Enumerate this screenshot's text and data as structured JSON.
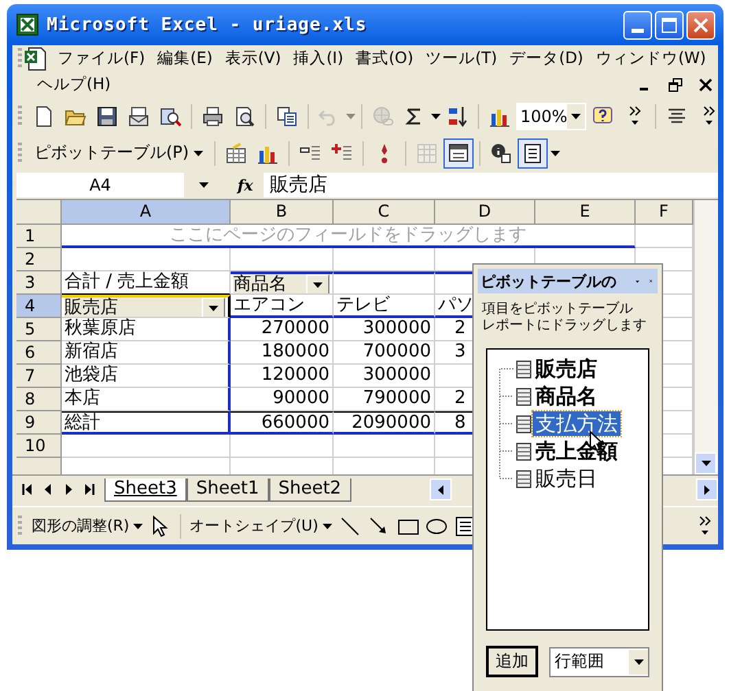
{
  "window": {
    "title": "Microsoft Excel - uriage.xls"
  },
  "menu_bar": {
    "items": [
      "ファイル(F)",
      "編集(E)",
      "表示(V)",
      "挿入(I)",
      "書式(O)",
      "ツール(T)",
      "データ(D)",
      "ウィンドウ(W)",
      "ヘルプ(H)"
    ]
  },
  "standard_toolbar": {
    "buttons": [
      {
        "kind": "new",
        "disabled": false
      },
      {
        "kind": "open",
        "disabled": false
      },
      {
        "kind": "save",
        "disabled": false
      },
      {
        "kind": "mail",
        "disabled": false
      },
      {
        "kind": "research",
        "disabled": false
      },
      {
        "kind": "separator"
      },
      {
        "kind": "print",
        "disabled": false
      },
      {
        "kind": "preview",
        "disabled": false
      },
      {
        "kind": "separator"
      },
      {
        "kind": "copy",
        "disabled": false
      },
      {
        "kind": "separator"
      },
      {
        "kind": "undo",
        "disabled": true
      },
      {
        "kind": "separator"
      },
      {
        "kind": "hyperlink",
        "disabled": true
      },
      {
        "kind": "autosum",
        "disabled": false
      },
      {
        "kind": "sort",
        "disabled": false
      },
      {
        "kind": "separator"
      },
      {
        "kind": "chart",
        "disabled": false
      },
      {
        "kind": "zoom",
        "value": "100%"
      },
      {
        "kind": "help",
        "disabled": false
      },
      {
        "kind": "more"
      },
      {
        "kind": "separator"
      },
      {
        "kind": "align",
        "disabled": false
      },
      {
        "kind": "more"
      }
    ]
  },
  "pivot_toolbar": {
    "menu": "ピボットテーブル(P)",
    "buttons": [
      {
        "kind": "separator"
      },
      {
        "kind": "format",
        "disabled": false,
        "pressed": false
      },
      {
        "kind": "chart",
        "disabled": false,
        "pressed": false
      },
      {
        "kind": "separator"
      },
      {
        "kind": "hide",
        "disabled": false,
        "pressed": false
      },
      {
        "kind": "show",
        "disabled": false,
        "pressed": false
      },
      {
        "kind": "separator"
      },
      {
        "kind": "refresh",
        "disabled": false,
        "pressed": false
      },
      {
        "kind": "separator"
      },
      {
        "kind": "hidden_items",
        "disabled": true,
        "pressed": false
      },
      {
        "kind": "always_show",
        "disabled": false,
        "pressed": true
      },
      {
        "kind": "separator"
      },
      {
        "kind": "settings",
        "disabled": false,
        "pressed": false
      },
      {
        "kind": "field_list",
        "disabled": false,
        "pressed": true
      }
    ]
  },
  "formula_bar": {
    "name_box": "A4",
    "function_label": "fx",
    "formula": "販売店"
  },
  "sheet": {
    "columns": [
      {
        "label": "A",
        "selected": true
      },
      {
        "label": "B",
        "selected": false
      },
      {
        "label": "C",
        "selected": false
      },
      {
        "label": "D",
        "selected": false
      },
      {
        "label": "E",
        "selected": false
      },
      {
        "label": "F",
        "selected": false
      }
    ],
    "rows": [
      {
        "header": "1",
        "selected": false,
        "kind": "drop_zone",
        "text": "ここにページのフィールドをドラッグします"
      },
      {
        "header": "2",
        "selected": false,
        "kind": "blank"
      },
      {
        "header": "3",
        "selected": false,
        "kind": "column_field",
        "cells": [
          "合計 / 売上金額",
          {
            "text": "商品名",
            "kind": "field"
          }
        ]
      },
      {
        "header": "4",
        "selected": true,
        "kind": "row_field",
        "cells": [
          {
            "text": "販売店",
            "kind": "field"
          },
          "エアコン",
          "テレビ",
          "パソ"
        ]
      },
      {
        "header": "5",
        "selected": false,
        "kind": "data",
        "cells": [
          "秋葉原店",
          "270000",
          "300000",
          "2"
        ]
      },
      {
        "header": "6",
        "selected": false,
        "kind": "data",
        "cells": [
          "新宿店",
          "180000",
          "700000",
          "3"
        ]
      },
      {
        "header": "7",
        "selected": false,
        "kind": "data",
        "cells": [
          "池袋店",
          "120000",
          "300000",
          null
        ]
      },
      {
        "header": "8",
        "selected": false,
        "kind": "data",
        "cells": [
          "本店",
          "90000",
          "790000",
          "2"
        ]
      },
      {
        "header": "9",
        "selected": false,
        "kind": "total",
        "cells": [
          "総計",
          "660000",
          "2090000",
          "8"
        ]
      },
      {
        "header": "10",
        "selected": false,
        "kind": "blank"
      }
    ],
    "tabs": [
      {
        "label": "Sheet3",
        "selected": true
      },
      {
        "label": "Sheet1",
        "selected": false
      },
      {
        "label": "Sheet2",
        "selected": false
      }
    ]
  },
  "drawing_toolbar": {
    "draw_menu": "図形の調整(R)",
    "autoshape_menu": "オートシェイプ(U)"
  },
  "pivot_field_list": {
    "title": "ピボットテーブルの",
    "instructions": [
      "項目をピボットテーブル",
      "レポートにドラッグします"
    ],
    "fields": [
      {
        "label": "販売店",
        "in_report": true,
        "selected": false
      },
      {
        "label": "商品名",
        "in_report": true,
        "selected": false
      },
      {
        "label": "支払方法",
        "in_report": false,
        "selected": true
      },
      {
        "label": "売上金額",
        "in_report": true,
        "selected": false
      },
      {
        "label": "販売日",
        "in_report": false,
        "selected": false
      }
    ],
    "add_button": "追加",
    "area": "行範囲"
  }
}
